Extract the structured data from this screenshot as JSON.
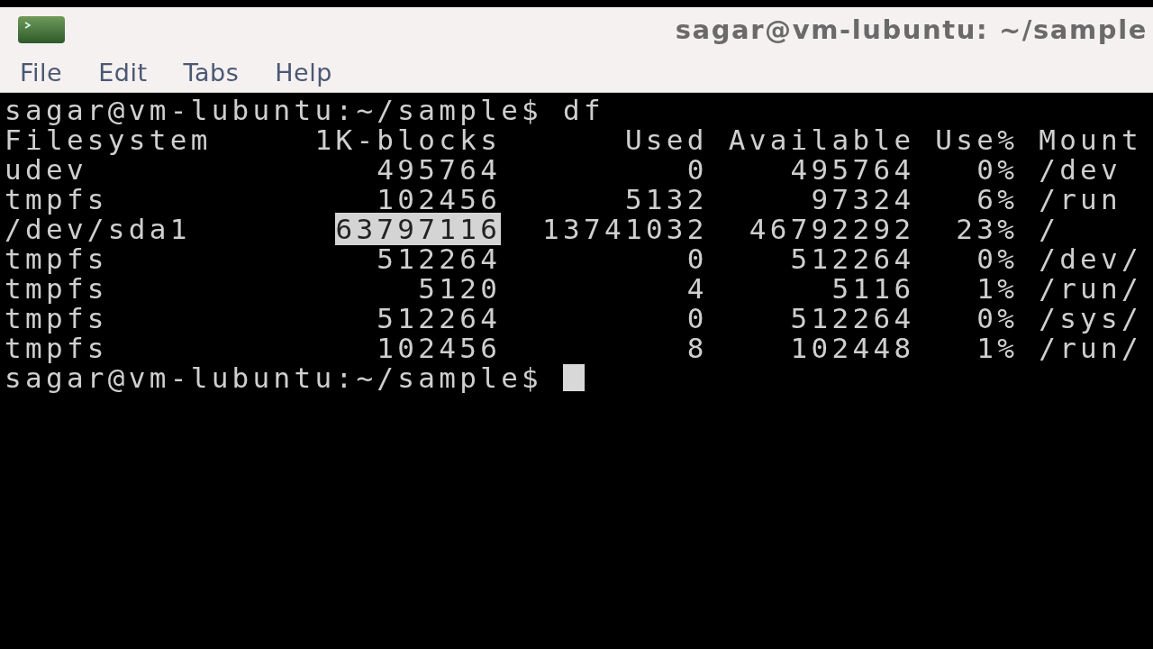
{
  "window": {
    "title": "sagar@vm-lubuntu: ~/sample"
  },
  "menu": [
    {
      "label": "File"
    },
    {
      "label": "Edit"
    },
    {
      "label": "Tabs"
    },
    {
      "label": "Help"
    }
  ],
  "terminal": {
    "lines": [
      [
        {
          "text": "sagar@vm-lubuntu:~/sample$ df",
          "selected": false
        }
      ],
      [
        {
          "text": "Filesystem     1K-blocks      Used Available Use% Mount",
          "selected": false
        }
      ],
      [
        {
          "text": "udev              495764         0    495764   0% /dev",
          "selected": false
        }
      ],
      [
        {
          "text": "tmpfs             102456      5132     97324   6% /run",
          "selected": false
        }
      ],
      [
        {
          "text": "/dev/sda1       ",
          "selected": false
        },
        {
          "text": "63797116",
          "selected": true
        },
        {
          "text": "  13741032  46792292  23% /",
          "selected": false
        }
      ],
      [
        {
          "text": "tmpfs             512264         0    512264   0% /dev/",
          "selected": false
        }
      ],
      [
        {
          "text": "tmpfs               5120         4      5116   1% /run/",
          "selected": false
        }
      ],
      [
        {
          "text": "tmpfs             512264         0    512264   0% /sys/",
          "selected": false
        }
      ],
      [
        {
          "text": "tmpfs             102456         8    102448   1% /run/",
          "selected": false
        }
      ],
      [
        {
          "text": "sagar@vm-lubuntu:~/sample$ ",
          "selected": false
        }
      ]
    ],
    "cursor_visible": true
  }
}
